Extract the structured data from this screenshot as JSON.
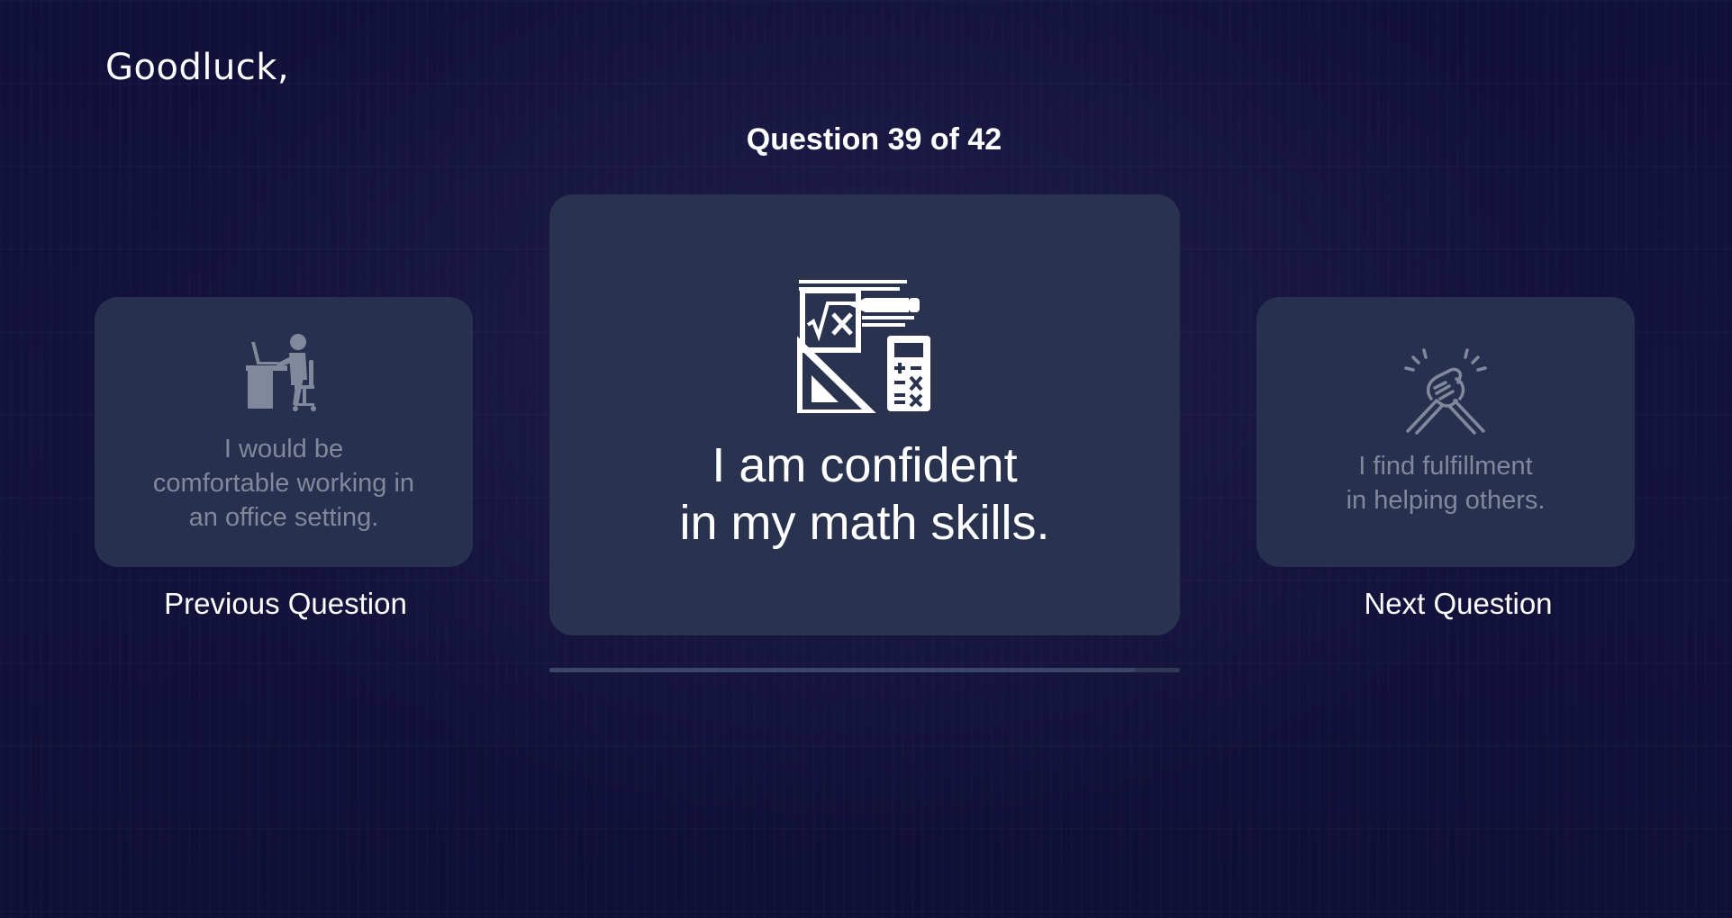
{
  "header": {
    "greeting": "Goodluck,",
    "counter": "Question 39 of 42"
  },
  "progress": {
    "current": 39,
    "total": 42,
    "fraction": 0.9286
  },
  "previous": {
    "text": "I would be\ncomfortable working in\nan office setting.",
    "icon": "office-worker-icon",
    "caption": "Previous Question"
  },
  "current": {
    "text": "I am confident\nin my math skills.",
    "icon": "math-tools-icon"
  },
  "next": {
    "text": "I find fulfillment\nin helping others.",
    "icon": "handshake-icon",
    "caption": "Next Question"
  },
  "colors": {
    "background": "#11103a",
    "card": "#293350",
    "muted_text": "#8c92a3",
    "text": "#ffffff"
  }
}
